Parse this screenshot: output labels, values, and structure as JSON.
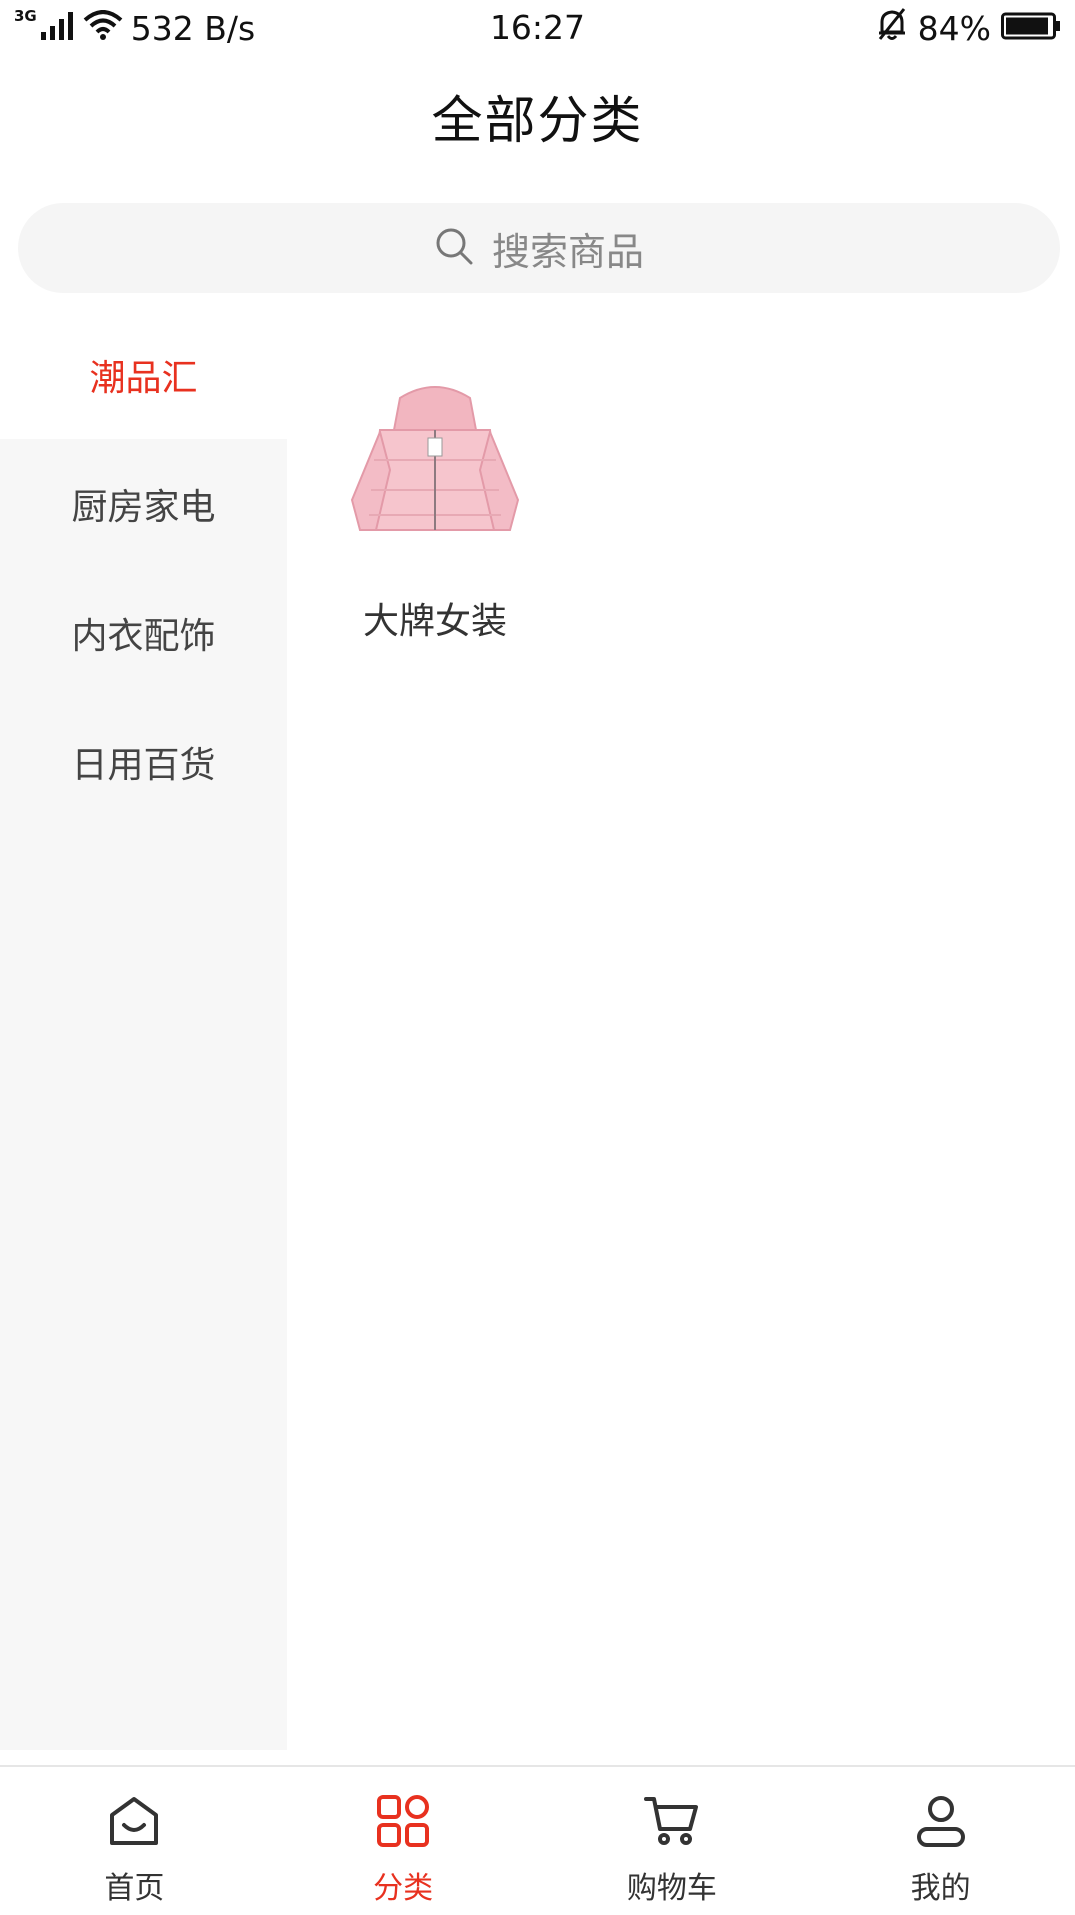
{
  "status_bar": {
    "network_type": "3G",
    "speed": "532 B/s",
    "time": "16:27",
    "battery": "84%"
  },
  "header": {
    "title": "全部分类"
  },
  "search": {
    "placeholder": "搜索商品",
    "icon": "search-icon"
  },
  "sidebar": {
    "items": [
      {
        "label": "潮品汇",
        "active": true
      },
      {
        "label": "厨房家电",
        "active": false
      },
      {
        "label": "内衣配饰",
        "active": false
      },
      {
        "label": "日用百货",
        "active": false
      }
    ]
  },
  "content": {
    "subcategories": [
      {
        "label": "大牌女装",
        "image": "pink-down-jacket"
      }
    ]
  },
  "tabbar": {
    "items": [
      {
        "label": "首页",
        "icon": "home-icon",
        "active": false
      },
      {
        "label": "分类",
        "icon": "category-grid-icon",
        "active": true
      },
      {
        "label": "购物车",
        "icon": "cart-icon",
        "active": false
      },
      {
        "label": "我的",
        "icon": "user-icon",
        "active": false
      }
    ]
  },
  "colors": {
    "accent": "#e8311f",
    "sidebar_bg": "#f7f7f7",
    "search_bg": "#f5f5f5"
  }
}
